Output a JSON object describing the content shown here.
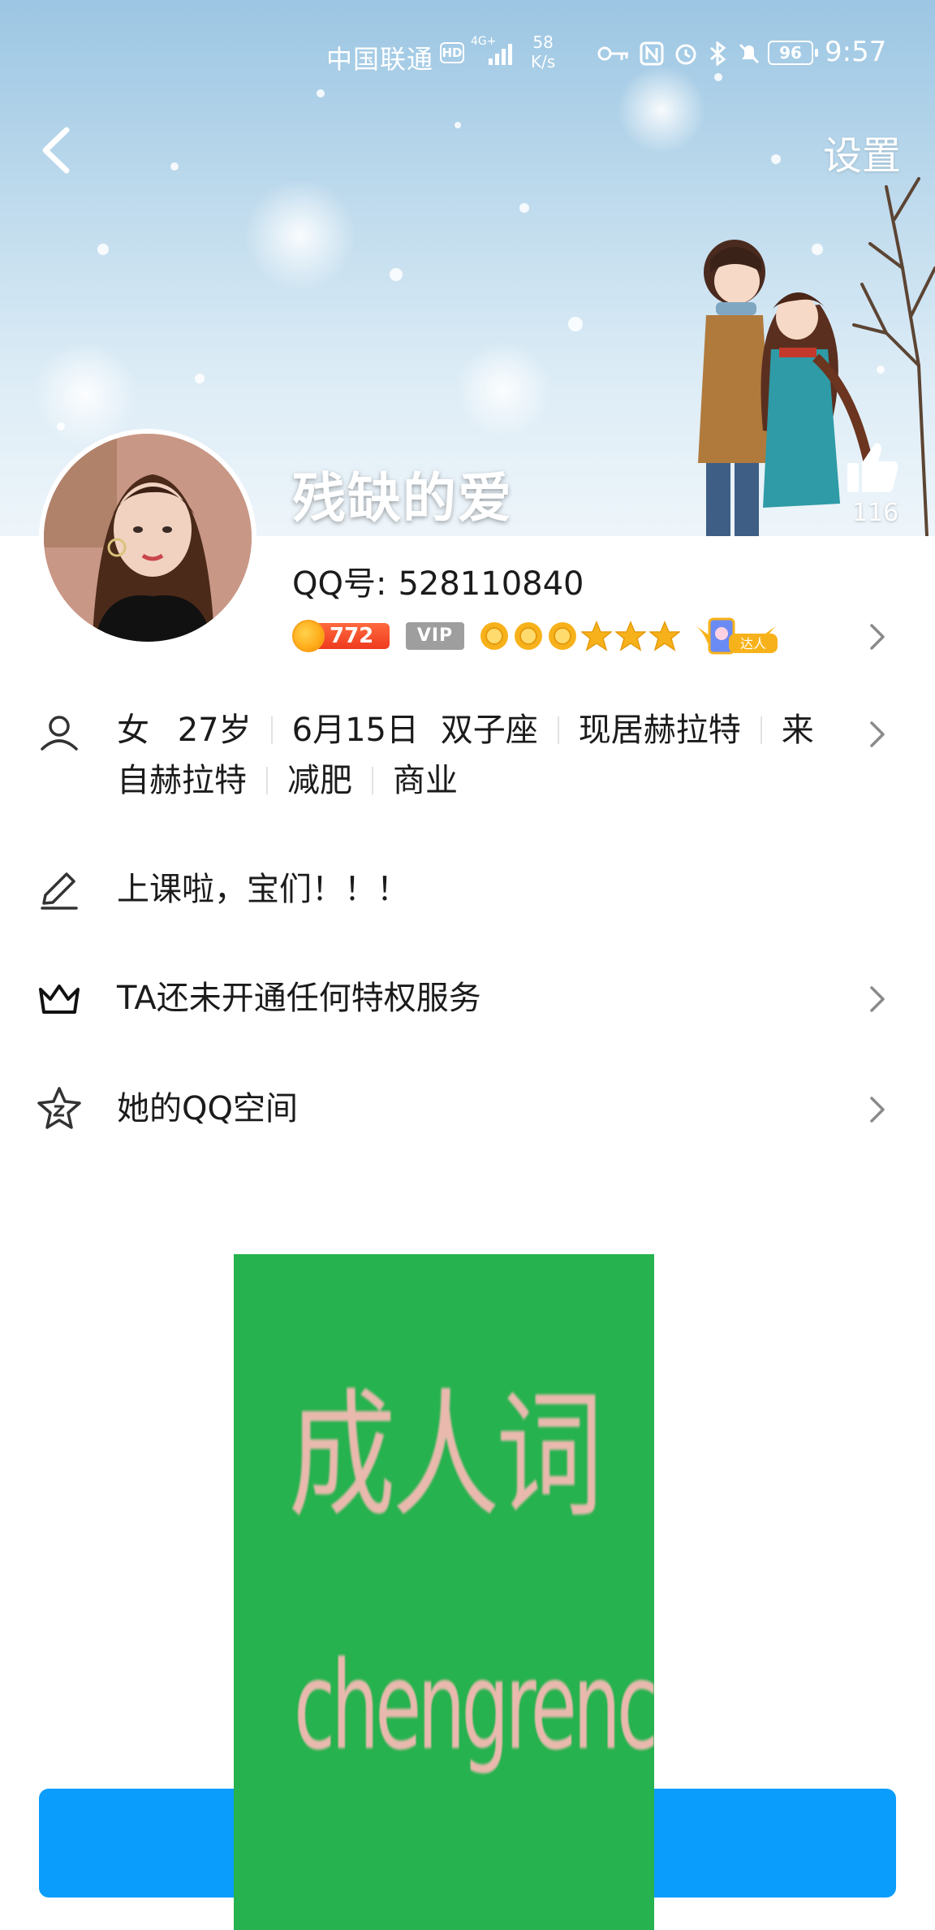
{
  "status_bar": {
    "carrier": "中国联通",
    "hd": "HD",
    "network": "4G+",
    "speed_value": "58",
    "speed_unit": "K/s",
    "battery": "96",
    "time": "9:57",
    "icons": [
      "key-icon",
      "nfc-icon",
      "alarm-icon",
      "bluetooth-icon",
      "mute-icon"
    ]
  },
  "header": {
    "back_icon": "back-arrow-icon",
    "settings_label": "设置"
  },
  "profile": {
    "nickname": "残缺的爱",
    "like_count": "116",
    "qq_label": "QQ号:",
    "qq_number": "528110840",
    "coin_count": "772",
    "vip_label": "VIP",
    "level_icons": [
      "sun",
      "sun",
      "sun",
      "star",
      "star",
      "star"
    ],
    "daren_label": "达人"
  },
  "details": {
    "gender": "女",
    "age": "27岁",
    "birthday": "6月15日",
    "zodiac": "双子座",
    "location": "现居赫拉特",
    "hometown": "来自赫拉特",
    "hometown_first": "来",
    "hometown_rest": "自赫拉特",
    "tag1": "减肥",
    "tag2": "商业"
  },
  "signature": "上课啦，宝们！！！",
  "vip_service": "TA还未开通任何特权服务",
  "qzone": "她的QQ空间",
  "ad": {
    "title": "成人词",
    "url": "chengrenci.com"
  },
  "colors": {
    "accent_blue": "#0a9dfc",
    "ad_green": "#26b24e",
    "coin_red": "#ee3a1f",
    "vip_gray": "#9e9e9e",
    "level_gold": "#f7b21b"
  }
}
